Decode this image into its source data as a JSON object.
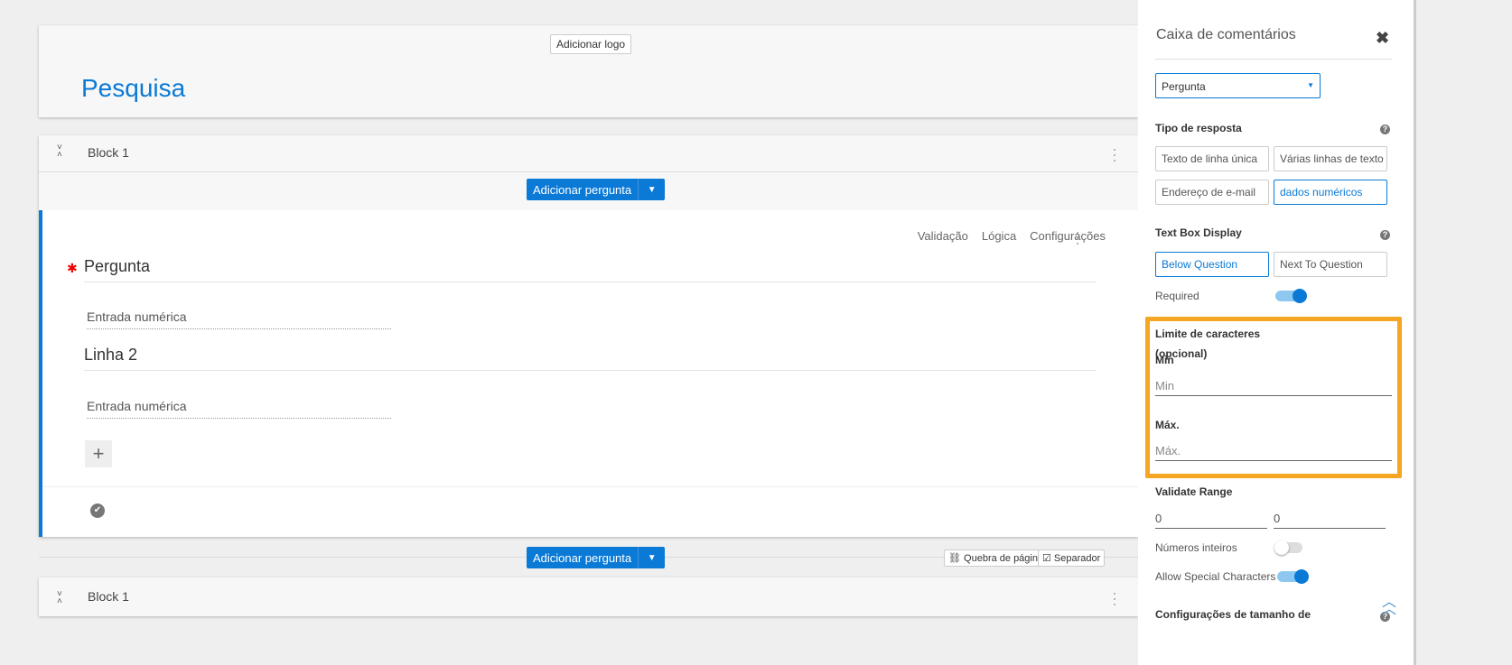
{
  "header": {
    "add_logo": "Adicionar logo",
    "title": "Pesquisa"
  },
  "block1": {
    "name": "Block 1",
    "add_question": "Adicionar pergunta"
  },
  "question": {
    "links": [
      "Validação",
      "Lógica",
      "Configurações"
    ],
    "row1": "Pergunta",
    "row1_input": "Entrada numérica",
    "row2": "Linha 2",
    "row2_input": "Entrada numérica"
  },
  "bottom_bar": {
    "add_question": "Adicionar pergunta",
    "page_break": "Quebra de página",
    "separator": "Separador"
  },
  "block2": {
    "name": "Block 1"
  },
  "panel": {
    "title": "Caixa de comentários",
    "select": "Pergunta",
    "response_type": {
      "label": "Tipo de resposta",
      "options": [
        "Texto de linha única",
        "Várias linhas de texto",
        "Endereço de e-mail",
        "dados numéricos"
      ],
      "selected": "dados numéricos"
    },
    "display": {
      "label": "Text Box Display",
      "options": [
        "Below Question",
        "Next To Question"
      ],
      "selected": "Below Question"
    },
    "required": {
      "label": "Required",
      "on": true
    },
    "char_limit": {
      "label": "Limite de caracteres",
      "optional": "(opcional)",
      "min_label": "Min",
      "min_placeholder": "Min",
      "max_label": "Máx.",
      "max_placeholder": "Máx."
    },
    "validate_range": {
      "label": "Validate Range",
      "min": "0",
      "max": "0"
    },
    "integers": {
      "label": "Números inteiros",
      "on": false
    },
    "special_chars": {
      "label": "Allow Special Characters",
      "on": true
    },
    "size_settings": {
      "label": "Configurações de tamanho de"
    }
  },
  "colors": {
    "accent": "#0a7ad6",
    "highlight": "#f5a623",
    "required": "#e00000"
  }
}
